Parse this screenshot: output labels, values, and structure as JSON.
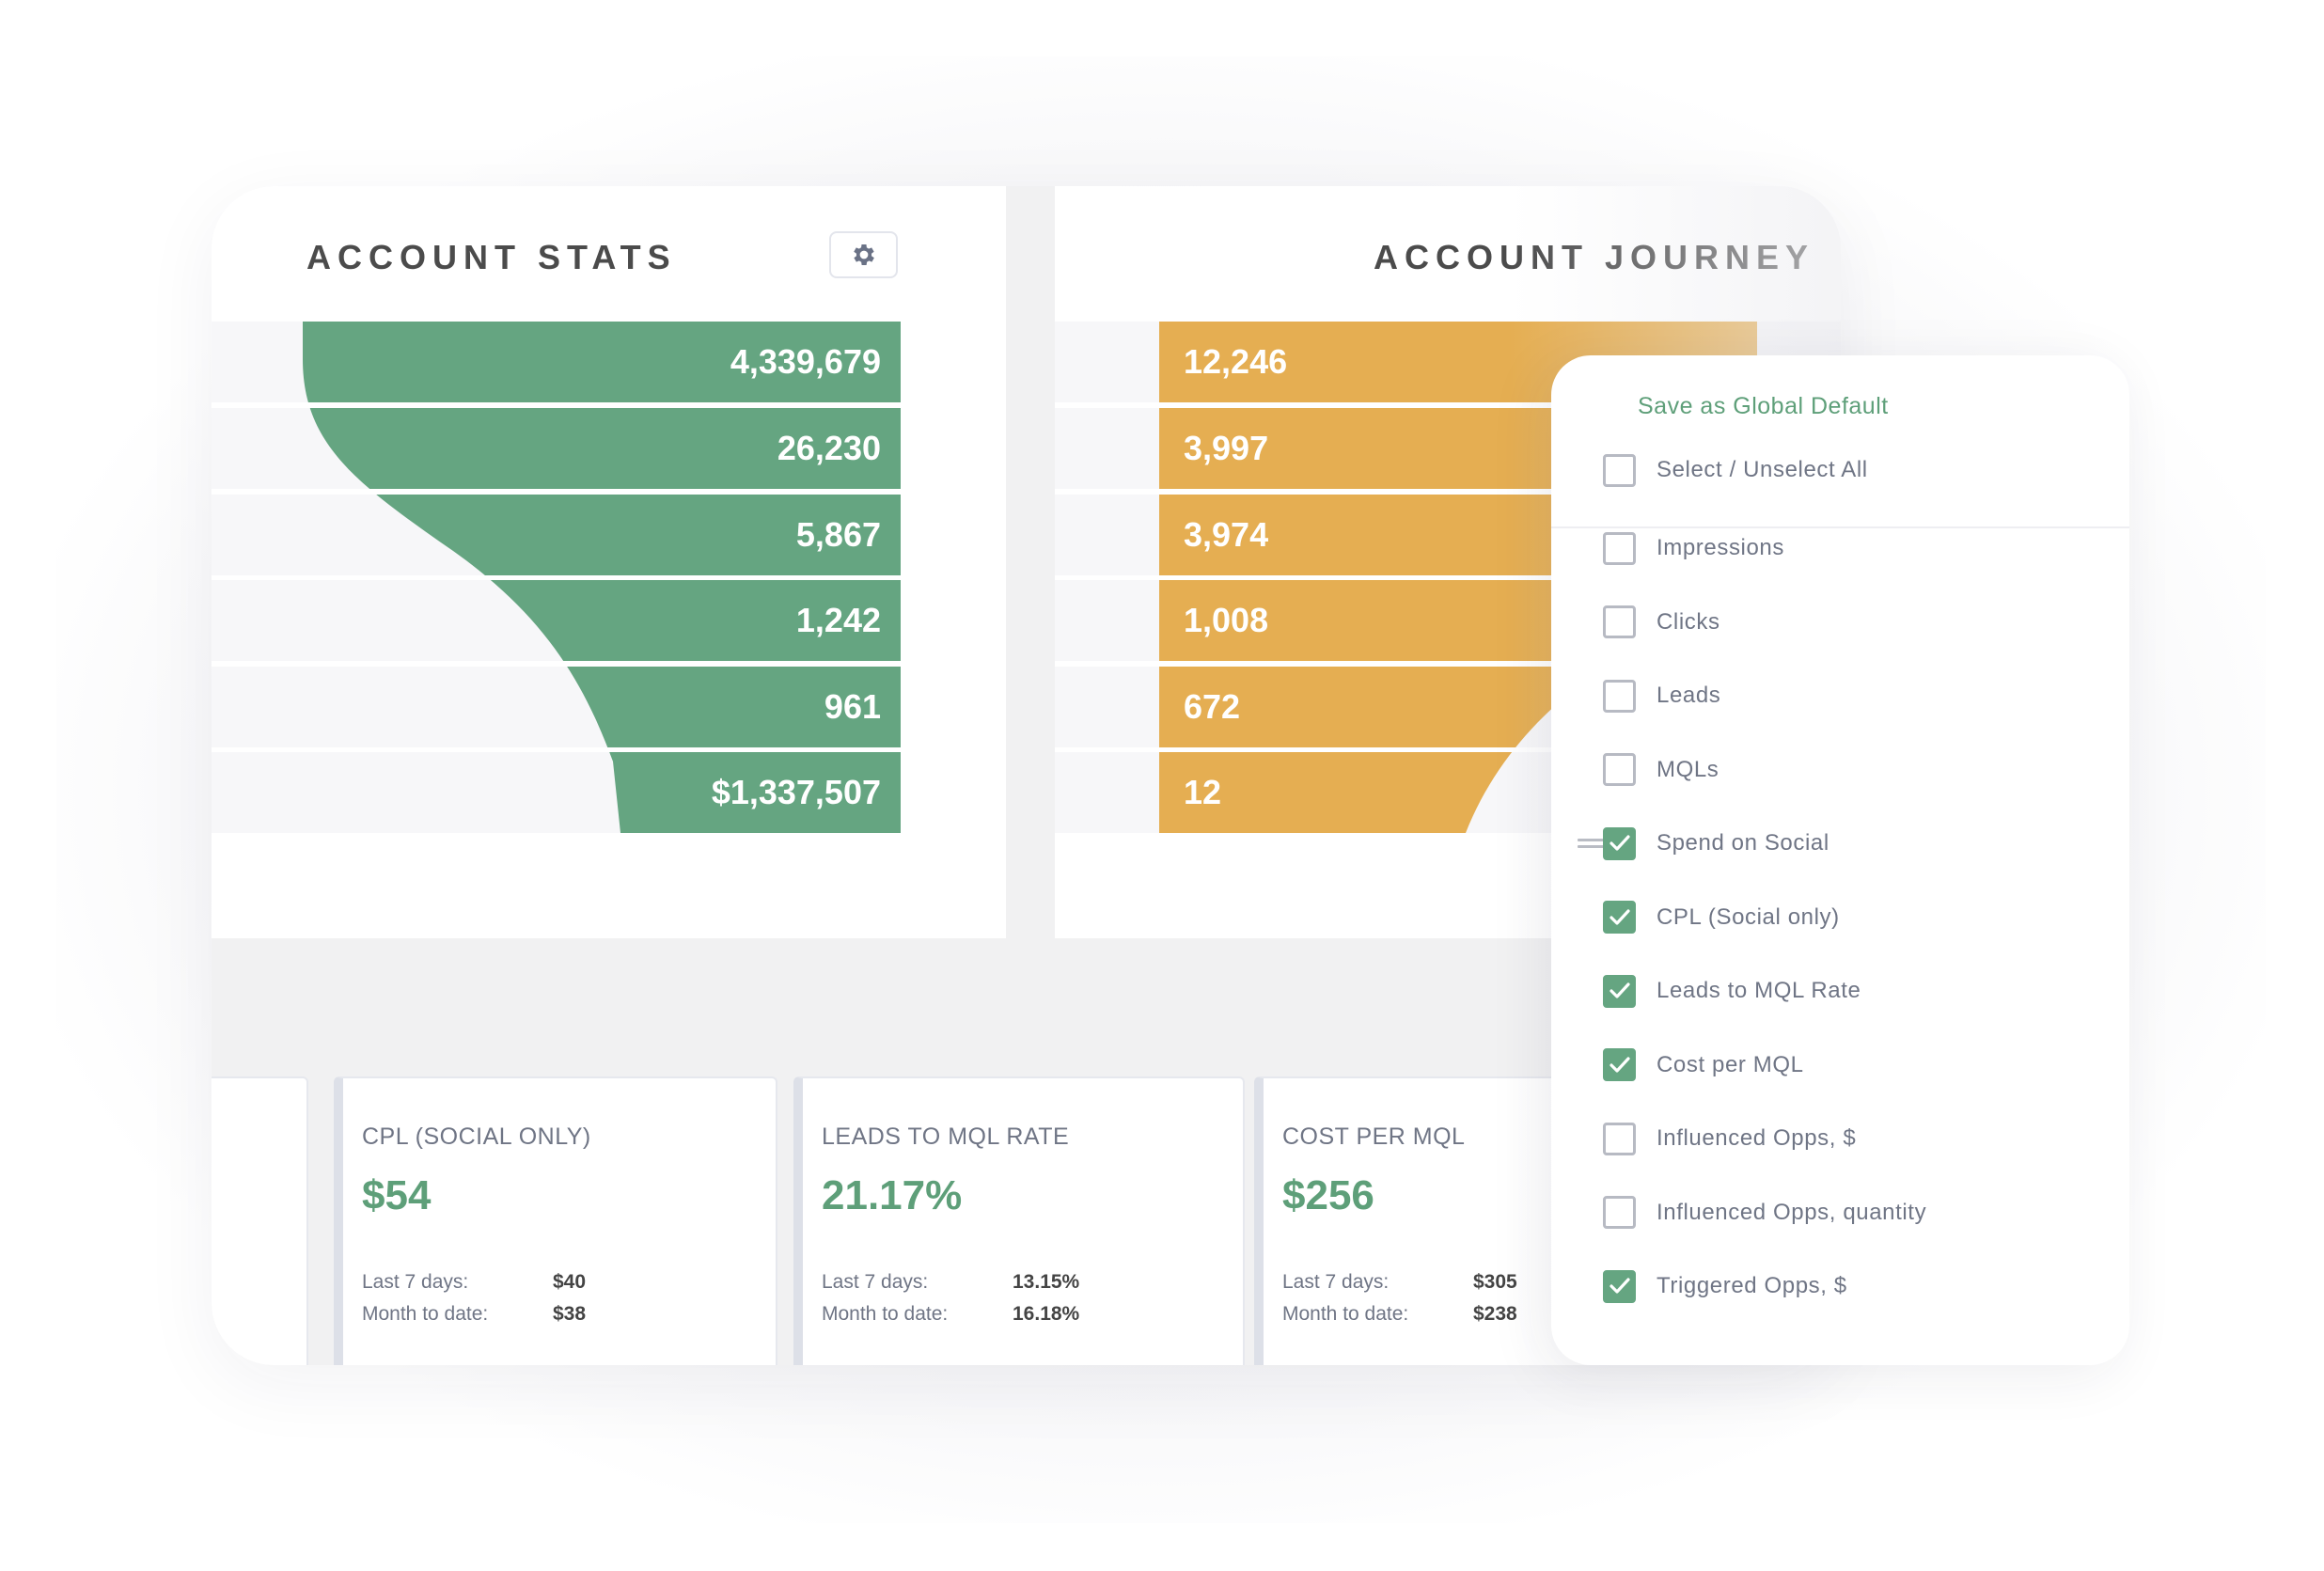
{
  "account_stats": {
    "title": "ACCOUNT STATS",
    "settings_icon": "gear-icon",
    "bar_color": "#65a581",
    "rows": [
      "4,339,679",
      "26,230",
      "5,867",
      "1,242",
      "961",
      "$1,337,507"
    ]
  },
  "account_journey": {
    "title": "ACCOUNT JOURNEY",
    "bar_color": "#e5ae52",
    "rows": [
      "12,246",
      "3,997",
      "3,974",
      "1,008",
      "672",
      "12"
    ]
  },
  "kpi_cards": [
    {
      "title": "CPL (SOCIAL ONLY)",
      "value": "$54",
      "last7_label": "Last 7 days:",
      "last7_value": "$40",
      "mtd_label": "Month to date:",
      "mtd_value": "$38"
    },
    {
      "title": "LEADS TO MQL RATE",
      "value": "21.17%",
      "last7_label": "Last 7 days:",
      "last7_value": "13.15%",
      "mtd_label": "Month to date:",
      "mtd_value": "16.18%"
    },
    {
      "title": "COST PER MQL",
      "value": "$256",
      "last7_label": "Last 7 days:",
      "last7_value": "$305",
      "mtd_label": "Month to date:",
      "mtd_value": "$238"
    }
  ],
  "metrics_menu": {
    "save_default_label": "Save as Global Default",
    "select_all_label": "Select / Unselect All",
    "select_all_checked": false,
    "accent_color": "#65a581",
    "options": [
      {
        "label": "Impressions",
        "checked": false
      },
      {
        "label": "Clicks",
        "checked": false
      },
      {
        "label": "Leads",
        "checked": false
      },
      {
        "label": "MQLs",
        "checked": false
      },
      {
        "label": "Spend on Social",
        "checked": true,
        "drag_handle": true
      },
      {
        "label": "CPL (Social only)",
        "checked": true
      },
      {
        "label": "Leads to MQL Rate",
        "checked": true
      },
      {
        "label": "Cost per MQL",
        "checked": true
      },
      {
        "label": "Influenced Opps, $",
        "checked": false
      },
      {
        "label": "Influenced Opps, quantity",
        "checked": false
      },
      {
        "label": "Triggered Opps, $",
        "checked": true
      }
    ]
  }
}
